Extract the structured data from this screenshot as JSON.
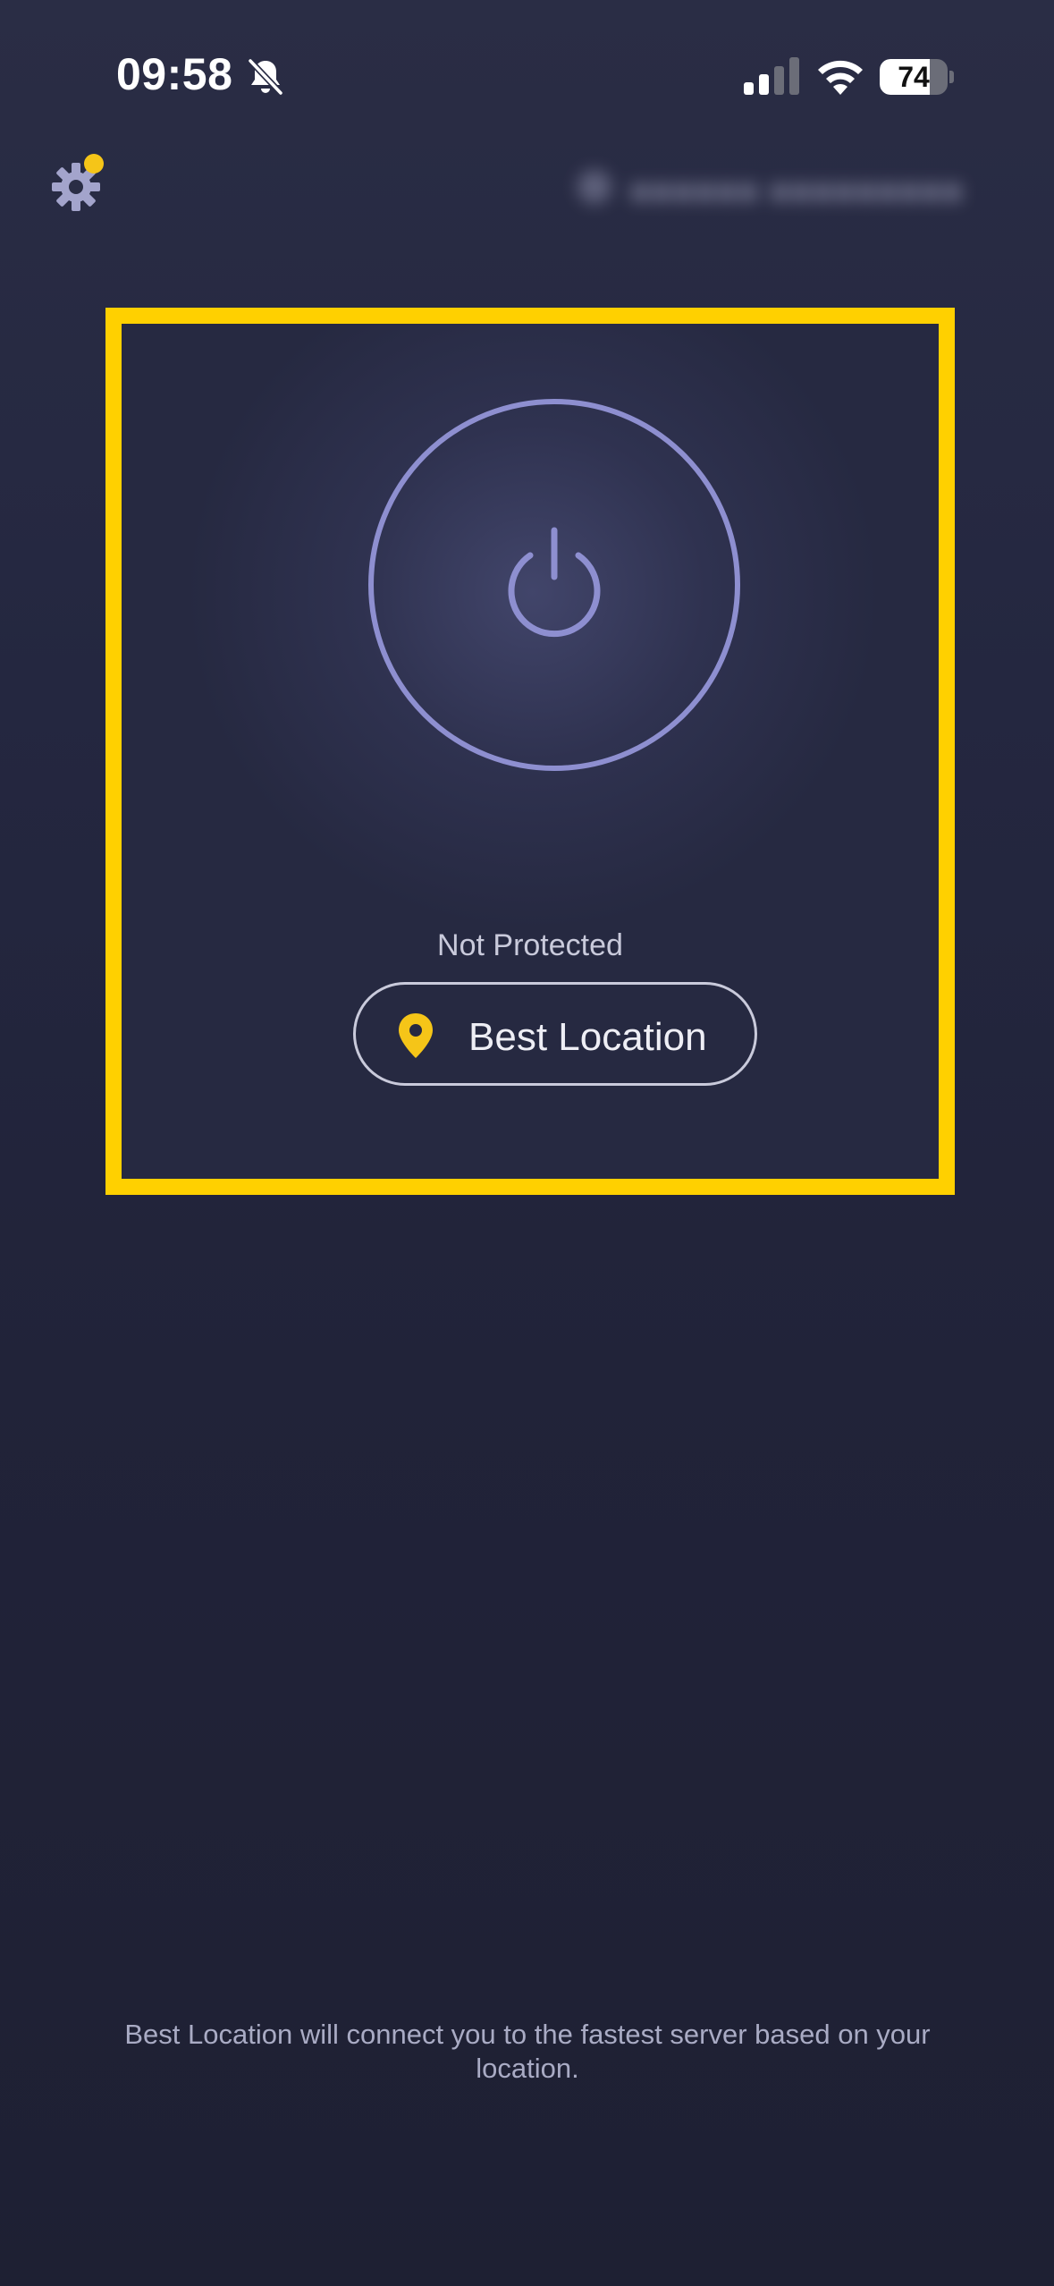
{
  "status_bar": {
    "time": "09:58",
    "battery_level": "74",
    "battery_fraction": 0.74,
    "signal_bars_active": 2,
    "signal_bars_total": 4,
    "icons": [
      "bell-slash-icon",
      "signal-icon",
      "wifi-icon",
      "battery-icon"
    ]
  },
  "header": {
    "settings_icon": "gear-icon",
    "notification_dot_color": "#f5c518",
    "account_icon": "user-icon"
  },
  "main": {
    "power_icon": "power-icon",
    "status_text": "Not Protected",
    "location_button": {
      "icon": "map-pin-icon",
      "label": "Best Location"
    }
  },
  "footer": {
    "hint": "Best Location will connect you to the fastest server based on your location."
  },
  "colors": {
    "highlight": "#ffd000",
    "accent": "#f5c518",
    "power_ring": "#8e8fd0",
    "background": "#242740"
  }
}
